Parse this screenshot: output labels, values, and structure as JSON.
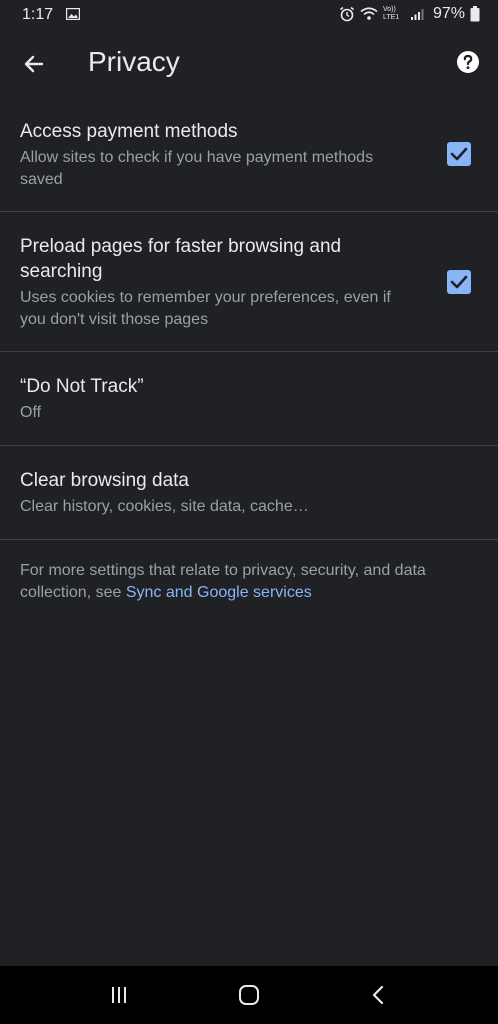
{
  "status_bar": {
    "time": "1:17",
    "battery": "97%",
    "network_label": "Vo)) LTE1"
  },
  "toolbar": {
    "title": "Privacy",
    "back_icon": "arrow-left-icon",
    "help_icon": "help-circle-icon"
  },
  "settings": [
    {
      "title": "Access payment methods",
      "summary": "Allow sites to check if you have payment methods saved",
      "checked": true
    },
    {
      "title": "Preload pages for faster browsing and searching",
      "summary": "Uses cookies to remember your preferences, even if you don't visit those pages",
      "checked": true
    },
    {
      "title": "“Do Not Track”",
      "summary": "Off"
    },
    {
      "title": "Clear browsing data",
      "summary": "Clear history, cookies, site data, cache…"
    }
  ],
  "footer": {
    "text": "For more settings that relate to privacy, security, and data collection, see ",
    "link": "Sync and Google services"
  },
  "colors": {
    "background": "#202124",
    "accent": "#8ab4f8",
    "divider": "#3c4043"
  }
}
